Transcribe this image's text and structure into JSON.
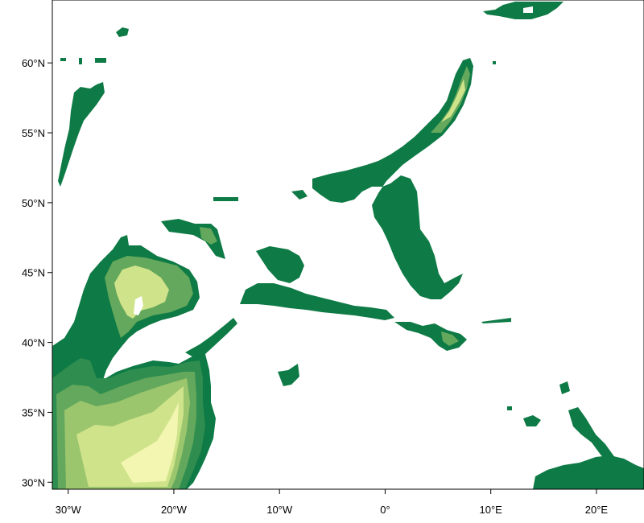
{
  "map": {
    "colors": {
      "frame": "#000000",
      "background": "#ffffff",
      "field_dark": "#0e7a45",
      "field_mid_dark": "#2e8d4f",
      "field_mid": "#63a85c",
      "field_mid_light": "#9cc66e",
      "field_light": "#cfe38a",
      "field_lightest": "#f2f6b0"
    },
    "y_axis": {
      "ticks": [
        {
          "value": 60,
          "label": "60°N"
        },
        {
          "value": 55,
          "label": "55°N"
        },
        {
          "value": 50,
          "label": "50°N"
        },
        {
          "value": 45,
          "label": "45°N"
        },
        {
          "value": 40,
          "label": "40°N"
        },
        {
          "value": 35,
          "label": "35°N"
        },
        {
          "value": 30,
          "label": "30°N"
        }
      ],
      "range": [
        29.5,
        64.5
      ]
    },
    "x_axis": {
      "ticks": [
        {
          "value": -30,
          "label": "30°W"
        },
        {
          "value": -20,
          "label": "20°W"
        },
        {
          "value": -10,
          "label": "10°W"
        },
        {
          "value": 0,
          "label": "0°"
        },
        {
          "value": 10,
          "label": "10°E"
        },
        {
          "value": 20,
          "label": "20°E"
        }
      ],
      "range": [
        -31.5,
        24.5
      ]
    }
  }
}
